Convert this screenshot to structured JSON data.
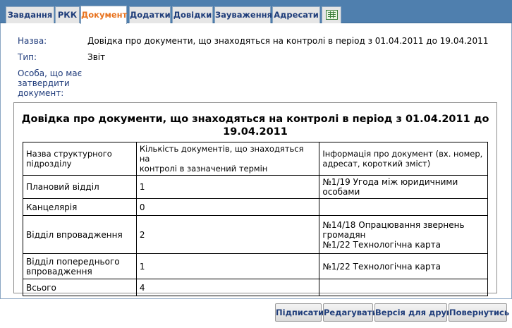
{
  "tabs": [
    {
      "label": "Завдання",
      "active": false
    },
    {
      "label": "РКК",
      "active": false
    },
    {
      "label": "Документ",
      "active": true
    },
    {
      "label": "Додатки",
      "active": false
    },
    {
      "label": "Довідки",
      "active": false
    },
    {
      "label": "Зауваження",
      "active": false
    },
    {
      "label": "Адресати",
      "active": false
    }
  ],
  "tab_icon": "spreadsheet-icon",
  "fields": {
    "name_label": "Назва:",
    "name_value": "Довідка про документи, що знаходяться на контролі в період з 01.04.2011 до 19.04.2011",
    "type_label": "Тип:",
    "type_value": "Звіт",
    "approver_label_line1": "Особа, що має",
    "approver_label_line2": "затвердити",
    "approver_label_line3": "документ:"
  },
  "report": {
    "title_line1": "Довідка про документи, що знаходяться на контролі в період з 01.04.2011 до",
    "title_line2": "19.04.2011",
    "headers": {
      "col1_line1": "Назва структурного",
      "col1_line2": "підрозділу",
      "col2_line1": "Кількість документів, що знаходяться на",
      "col2_line2": "контролі в зазначений термін",
      "col3_line1": "Інформація про документ (вх. номер,",
      "col3_line2": "адресат, короткий зміст)"
    },
    "rows": [
      {
        "dept_line1": "Плановий відділ",
        "dept_line2": "",
        "count": "1",
        "info_line1": "№1/19 Угода між юридичними особами",
        "info_line2": "",
        "info_line3": ""
      },
      {
        "dept_line1": "Канцелярія",
        "dept_line2": "",
        "count": "0",
        "info_line1": "",
        "info_line2": "",
        "info_line3": ""
      },
      {
        "dept_line1": "Відділ впровадження",
        "dept_line2": "",
        "count": "2",
        "info_line1": "№14/18 Опрацювання звернень",
        "info_line2": "громадян",
        "info_line3": "№1/22 Технологічна карта"
      },
      {
        "dept_line1": "Відділ попереднього",
        "dept_line2": "впровадження",
        "count": "1",
        "info_line1": "№1/22 Технологічна карта",
        "info_line2": "",
        "info_line3": ""
      },
      {
        "dept_line1": "Всього",
        "dept_line2": "",
        "count": "4",
        "info_line1": "",
        "info_line2": "",
        "info_line3": ""
      }
    ]
  },
  "buttons": {
    "sign": "Підписати",
    "edit": "Редагувати",
    "print": "Версія для друку",
    "back": "Повернутись"
  },
  "colors": {
    "tabbar_bg": "#4f7fae",
    "active_tab_text": "#e8731f",
    "tab_text": "#1f3d7a",
    "label_text": "#1e3a7a"
  }
}
